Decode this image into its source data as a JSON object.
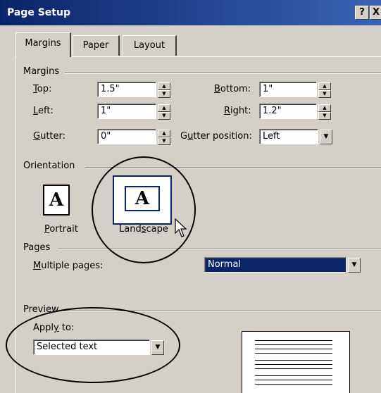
{
  "window": {
    "title": "Page Setup",
    "help_glyph": "?",
    "close_glyph": "X"
  },
  "tabs": [
    {
      "label": "Margins",
      "active": true
    },
    {
      "label": "Paper",
      "active": false
    },
    {
      "label": "Layout",
      "active": false
    }
  ],
  "margins": {
    "group_label": "Margins",
    "top": {
      "label_key": "T",
      "label_rest": "op:",
      "value": "1.5\""
    },
    "bottom": {
      "label_key": "B",
      "label_rest": "ottom:",
      "value": "1\""
    },
    "left": {
      "label_key": "L",
      "label_rest": "eft:",
      "value": "1\""
    },
    "right": {
      "label_key": "R",
      "label_rest": "ight:",
      "value": "1.2\""
    },
    "gutter": {
      "label_key": "G",
      "label_rest": "utter:",
      "value": "0\""
    },
    "gutter_position": {
      "label_pre": "G",
      "label_key": "u",
      "label_rest": "tter position:",
      "value": "Left"
    }
  },
  "orientation": {
    "group_label": "Orientation",
    "icon_glyph": "A",
    "portrait": {
      "label_key": "P",
      "label_rest": "ortrait"
    },
    "landscape": {
      "label_pre": "Land",
      "label_key": "s",
      "label_rest": "cape",
      "selected": true
    }
  },
  "pages": {
    "group_label": "Pages",
    "multiple_pages": {
      "label_key": "M",
      "label_rest": "ultiple pages:",
      "value": "Normal"
    }
  },
  "preview": {
    "group_label": "Preview",
    "apply_to": {
      "label_pre": "Appl",
      "label_key": "y",
      "label_rest": " to:",
      "value": "Selected text"
    }
  },
  "colors": {
    "dialog_bg": "#d4d0c8",
    "title_bar": "#0a246a",
    "selection": "#0a246a"
  }
}
